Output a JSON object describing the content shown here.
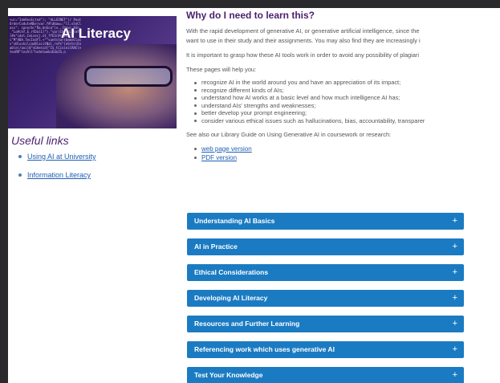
{
  "banner": {
    "title": "AI Literacy",
    "code_text": "<ur=\"IdeResEcted\"); \"ALLOINET\"(/ PoatOrderCoduteNEe)var.f#ldbaw=;\"ll.oleClass\": ipnorb(\"Ra.bnSca\")x.,(hpw)_bSn_\"Lo#chf,E.rtDal1]\"}.\"var(Chirdit)mf(#e\"idel.Cmisecj.ot_ffE3(#r\"1CS\"pc\"M\"ABA.TecIndfl.+\"\"vuetstar(bemeClass\"sBlockilcanBlocitNal.rsPs\"(eSrhr(Enable(/aoi]0\"vGhenid]\"IS_tCivinilRAC)ntexRR\"lnsAll\"hutmlwebcEdoIS,o"
  },
  "useful_links": {
    "title": "Useful links",
    "items": [
      {
        "label": "Using AI at University"
      },
      {
        "label": "Information Literacy"
      }
    ]
  },
  "main": {
    "heading": "Why do I need to learn this?",
    "para1_line1": "With the rapid development of generative AI, or generative artificial intelligence, since the",
    "para1_line2": "want to use in their study and their assignments.  You may also find they are increasingly i",
    "para2": "It is important to grasp how these AI tools work in order to avoid any possibility of plagiari",
    "para3": "These pages will help you:",
    "bullets": [
      "recognize AI in the world around you and have an appreciation of its impact;",
      "recognize different kinds of AIs;",
      "understand how AI works at a basic level and how much intelligence AI has;",
      "understand AIs' strengths and weaknesses;",
      "better develop your prompt engineering;",
      "consider various ethical issues such as hallucinations, bias, accountability, transparer"
    ],
    "see_also": "See also our Library Guide on Using Generative AI in coursework or research:",
    "links": [
      {
        "label": "web page version"
      },
      {
        "label": "PDF version"
      }
    ]
  },
  "accordion": {
    "sections": [
      {
        "label": "Understanding AI Basics"
      },
      {
        "label": "AI in Practice"
      },
      {
        "label": "Ethical Considerations"
      },
      {
        "label": "Developing AI Literacy"
      },
      {
        "label": "Resources and Further Learning"
      },
      {
        "label": "Referencing work which uses generative AI"
      },
      {
        "label": "Test Your Knowledge"
      }
    ],
    "expand_symbol": "+"
  },
  "colors": {
    "accent_purple": "#4b1f6e",
    "accordion_blue": "#1b7bc2",
    "link_blue": "#1f5fb2",
    "outer_background": "#2a2a2c"
  }
}
